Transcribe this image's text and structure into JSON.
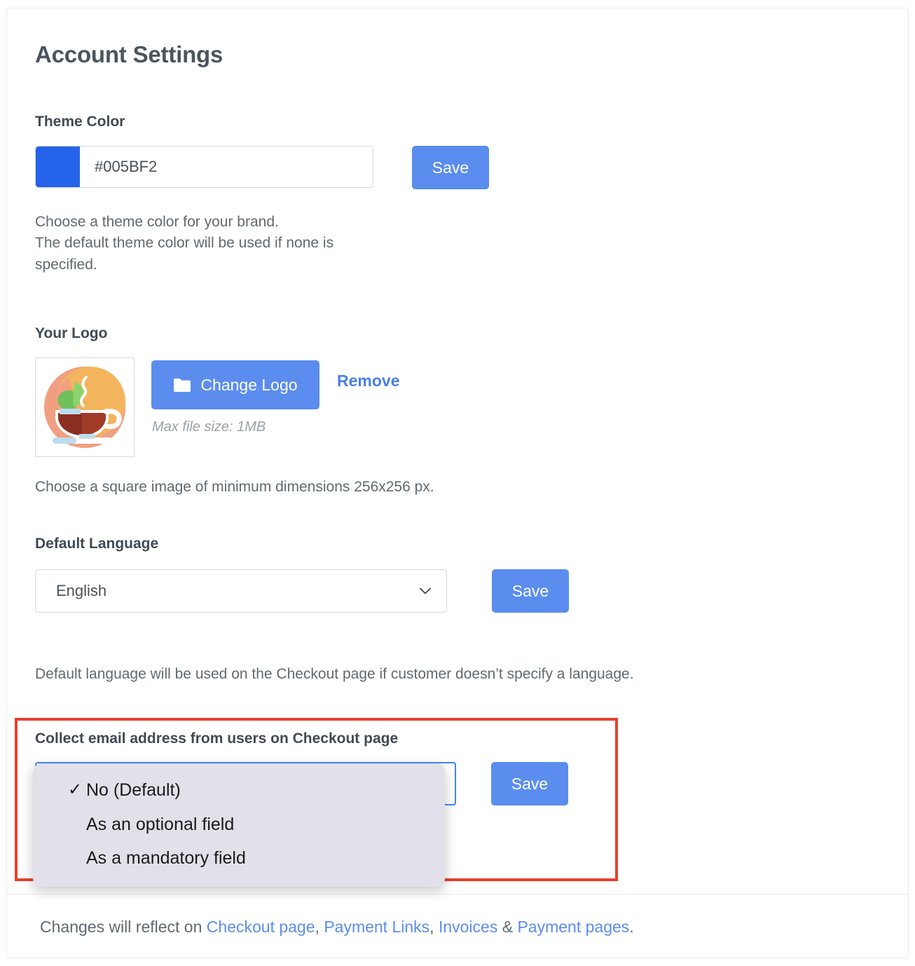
{
  "page": {
    "title": "Account Settings"
  },
  "theme_color": {
    "label": "Theme Color",
    "value": "#005BF2",
    "swatch_color": "#2563eb",
    "save_label": "Save",
    "helper_line1": "Choose a theme color for your brand.",
    "helper_line2": "The default theme color will be used if none is",
    "helper_line3": "specified."
  },
  "logo": {
    "label": "Your Logo",
    "change_label": "Change Logo",
    "remove_label": "Remove",
    "max_file_size": "Max file size: 1MB",
    "helper": "Choose a square image of minimum dimensions 256x256 px.",
    "icon_name": "coffee-cup-logo"
  },
  "language": {
    "label": "Default Language",
    "selected": "English",
    "save_label": "Save",
    "helper": "Default language will be used on the Checkout page if customer doesn’t specify a language."
  },
  "collect_email": {
    "label": "Collect email address from users on Checkout page",
    "save_label": "Save",
    "selected": "No (Default)",
    "options": [
      {
        "label": "No (Default)",
        "checked": true
      },
      {
        "label": "As an optional field",
        "checked": false
      },
      {
        "label": "As a mandatory field",
        "checked": false
      }
    ],
    "highlight_color": "#e8402a"
  },
  "footer": {
    "prefix": "Changes will reflect on ",
    "link1": "Checkout page",
    "sep1": ", ",
    "link2": "Payment Links",
    "sep2": ", ",
    "link3": "Invoices",
    "sep3": " & ",
    "link4": "Payment pages",
    "suffix": "."
  },
  "colors": {
    "accent_blue": "#5b8def",
    "link_blue": "#4a7fe8",
    "focus_blue": "#4285f4",
    "text_dark": "#3f4a54",
    "text_muted": "#5f6a72"
  }
}
